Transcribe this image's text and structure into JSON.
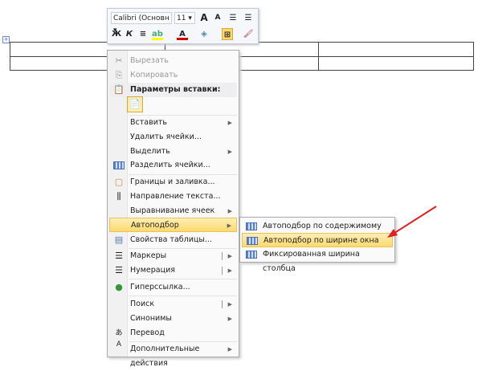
{
  "mini_toolbar": {
    "font_name": "Calibri (Основн",
    "font_size": "11",
    "bold": "Ж",
    "italic": "К",
    "grow_font": "A",
    "shrink_font": "A",
    "font_color": "A"
  },
  "context_menu": {
    "cut": "Вырезать",
    "copy": "Копировать",
    "paste_options": "Параметры вставки:",
    "insert": "Вставить",
    "delete_cells": "Удалить ячейки...",
    "select": "Выделить",
    "split_cells": "Разделить ячейки...",
    "borders": "Границы и заливка...",
    "text_direction": "Направление текста...",
    "cell_alignment": "Выравнивание ячеек",
    "autofit": "Автоподбор",
    "table_properties": "Свойства таблицы...",
    "bullets": "Маркеры",
    "numbering": "Нумерация",
    "hyperlink": "Гиперссылка...",
    "search": "Поиск",
    "synonyms": "Синонимы",
    "translate": "Перевод",
    "more_actions": "Дополнительные действия"
  },
  "autofit_submenu": {
    "contents": "Автоподбор по содержимому",
    "window": "Автоподбор по ширине окна",
    "fixed": "Фиксированная ширина столбца"
  },
  "colors": {
    "highlight": "#fbd96e",
    "arrow": "#e02020"
  }
}
